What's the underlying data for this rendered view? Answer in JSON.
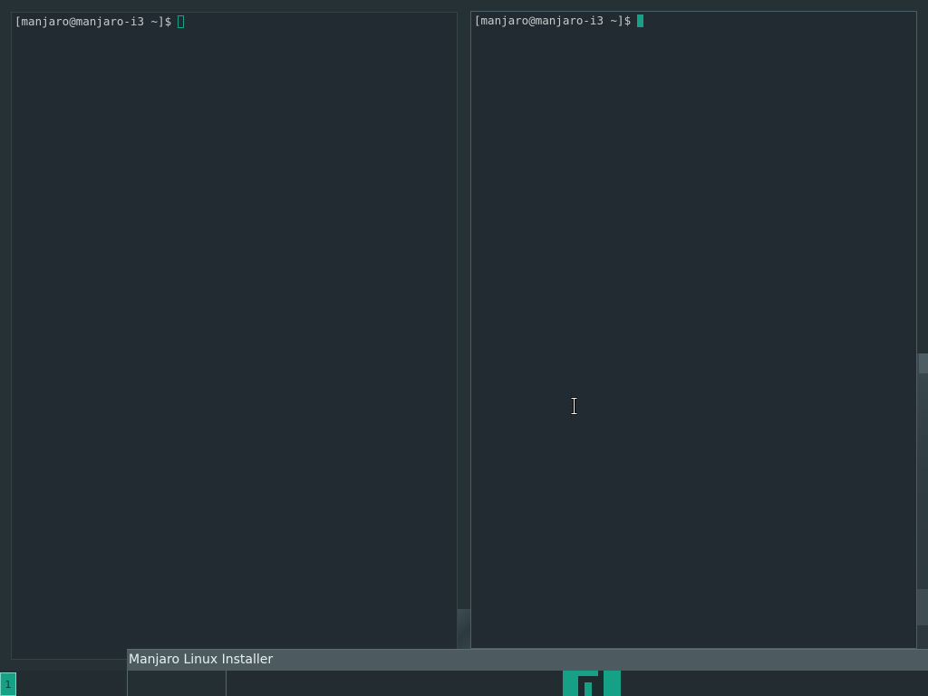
{
  "terminals": {
    "left": {
      "prompt": "[manjaro@manjaro-i3 ~]$",
      "cursor_style": "hollow"
    },
    "right": {
      "prompt": "[manjaro@manjaro-i3 ~]$",
      "cursor_style": "block",
      "focused": true
    }
  },
  "installer": {
    "title": "Manjaro Linux Installer"
  },
  "bar": {
    "workspace": "1"
  },
  "icons": {
    "pointer": "ibeam-cursor-icon",
    "logo": "manjaro-logo-icon"
  },
  "colors": {
    "accent": "#16a085",
    "terminal_bg": "#222b31",
    "desktop_bg": "#263136",
    "text": "#c6cbcd"
  }
}
